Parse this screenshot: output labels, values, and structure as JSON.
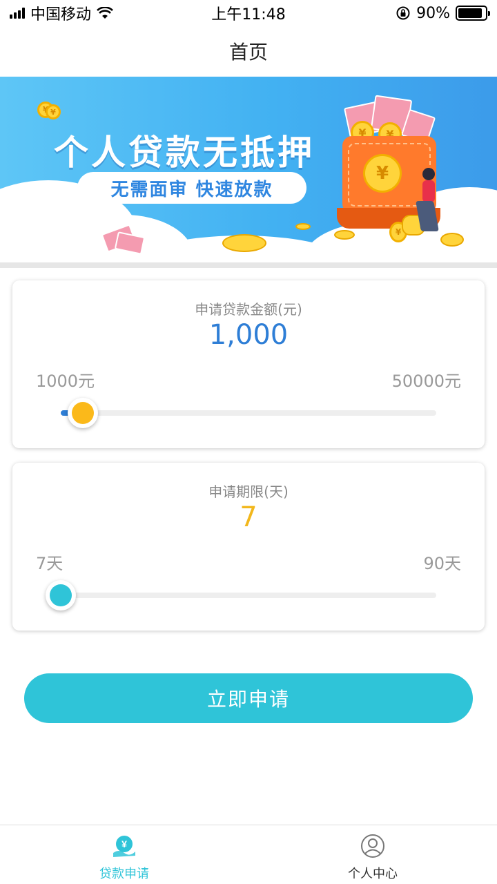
{
  "status_bar": {
    "carrier": "中国移动",
    "time": "上午11:48",
    "battery_percent": "90%",
    "battery_level": 0.9
  },
  "nav": {
    "title": "首页"
  },
  "banner": {
    "headline": "个人贷款无抵押",
    "tagline": "无需面审  快速放款"
  },
  "amount_card": {
    "label": "申请贷款金额(元)",
    "value": "1,000",
    "min_label": "1000元",
    "max_label": "50000元",
    "slider_fraction": 0.0,
    "accent": "#2e7ed6",
    "thumb_color": "#fbb91a"
  },
  "term_card": {
    "label": "申请期限(天)",
    "value": "7",
    "min_label": "7天",
    "max_label": "90天",
    "slider_fraction": 0.0,
    "accent": "#f2b71c",
    "thumb_color": "#2fc4d8"
  },
  "apply_button": {
    "label": "立即申请",
    "color": "#2fc4d8"
  },
  "tab_bar": {
    "items": [
      {
        "label": "贷款申请",
        "icon": "loan-icon",
        "active": true,
        "color": "#2fc4d8"
      },
      {
        "label": "个人中心",
        "icon": "user-icon",
        "active": false,
        "color": "#333333"
      }
    ]
  }
}
